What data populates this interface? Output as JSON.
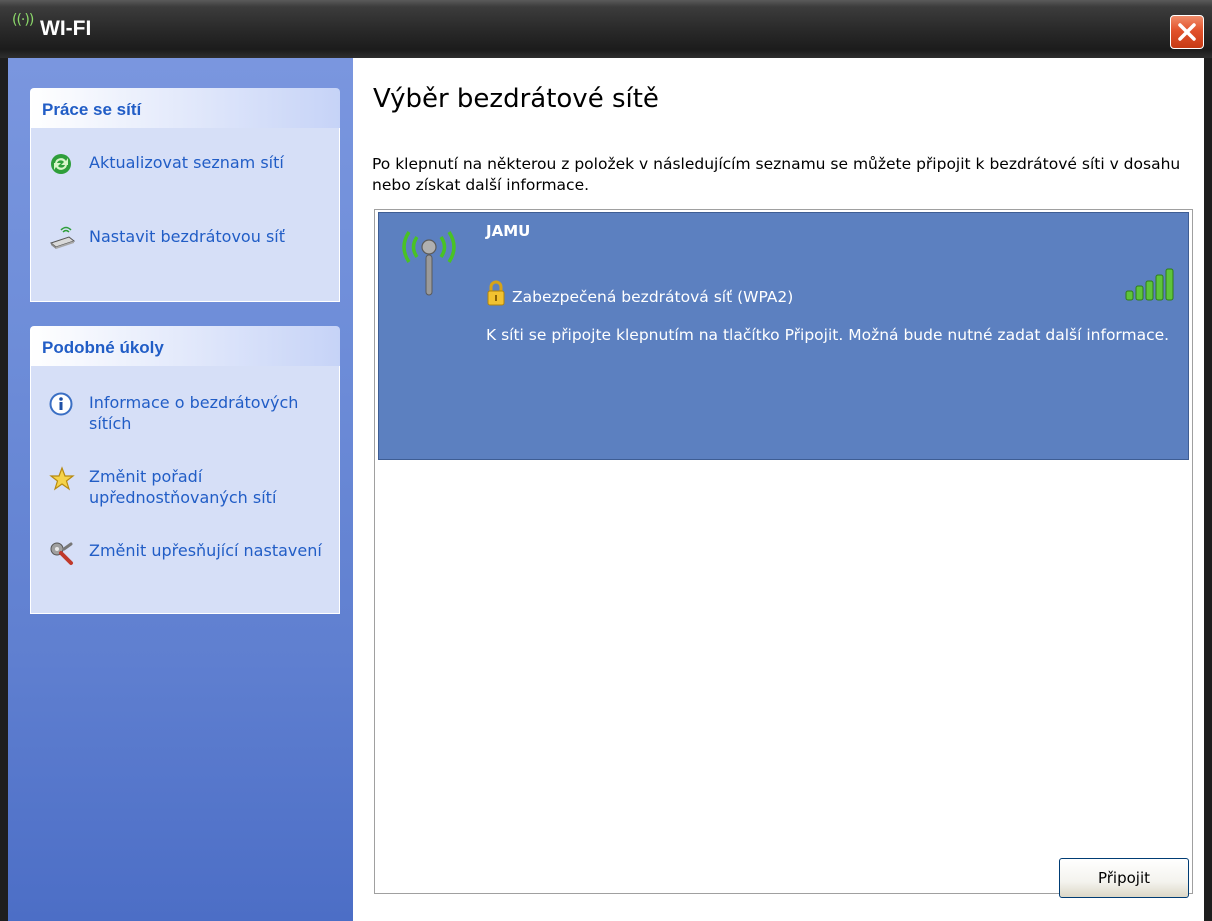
{
  "window": {
    "title": "WI-FI",
    "title_icon_glyph": "((·))",
    "close_icon": "close-icon"
  },
  "sidebar": {
    "network_tasks": {
      "header": "Práce se sítí",
      "items": [
        {
          "label": "Aktualizovat seznam sítí",
          "icon": "refresh-icon"
        },
        {
          "label": "Nastavit bezdrátovou síť",
          "icon": "wireless-setup-icon"
        }
      ]
    },
    "related_tasks": {
      "header": "Podobné úkoly",
      "items": [
        {
          "label": "Informace o bezdrátových sítích",
          "icon": "info-icon"
        },
        {
          "label": "Změnit pořadí upřednostňovaných sítí",
          "icon": "star-icon"
        },
        {
          "label": "Změnit upřesňující nastavení",
          "icon": "settings-icon"
        }
      ]
    }
  },
  "main": {
    "heading": "Výběr bezdrátové sítě",
    "description": "Po klepnutí na některou z položek v následujícím seznamu se můžete připojit k bezdrátové síti v dosahu nebo získat další informace.",
    "networks": [
      {
        "name": "JAMU",
        "security": "Zabezpečená bezdrátová síť (WPA2)",
        "info": "K síti se připojte klepnutím na tlačítko Připojit. Možná bude nutné zadat další informace.",
        "signal_bars_lit": 5,
        "signal_bars_total": 5
      }
    ],
    "connect_button": "Připojit"
  },
  "colors": {
    "sidebar": "#6f8ed9",
    "selected_item": "#5c80c0",
    "task_link": "#215dc6",
    "signal": "#5ec43a"
  }
}
